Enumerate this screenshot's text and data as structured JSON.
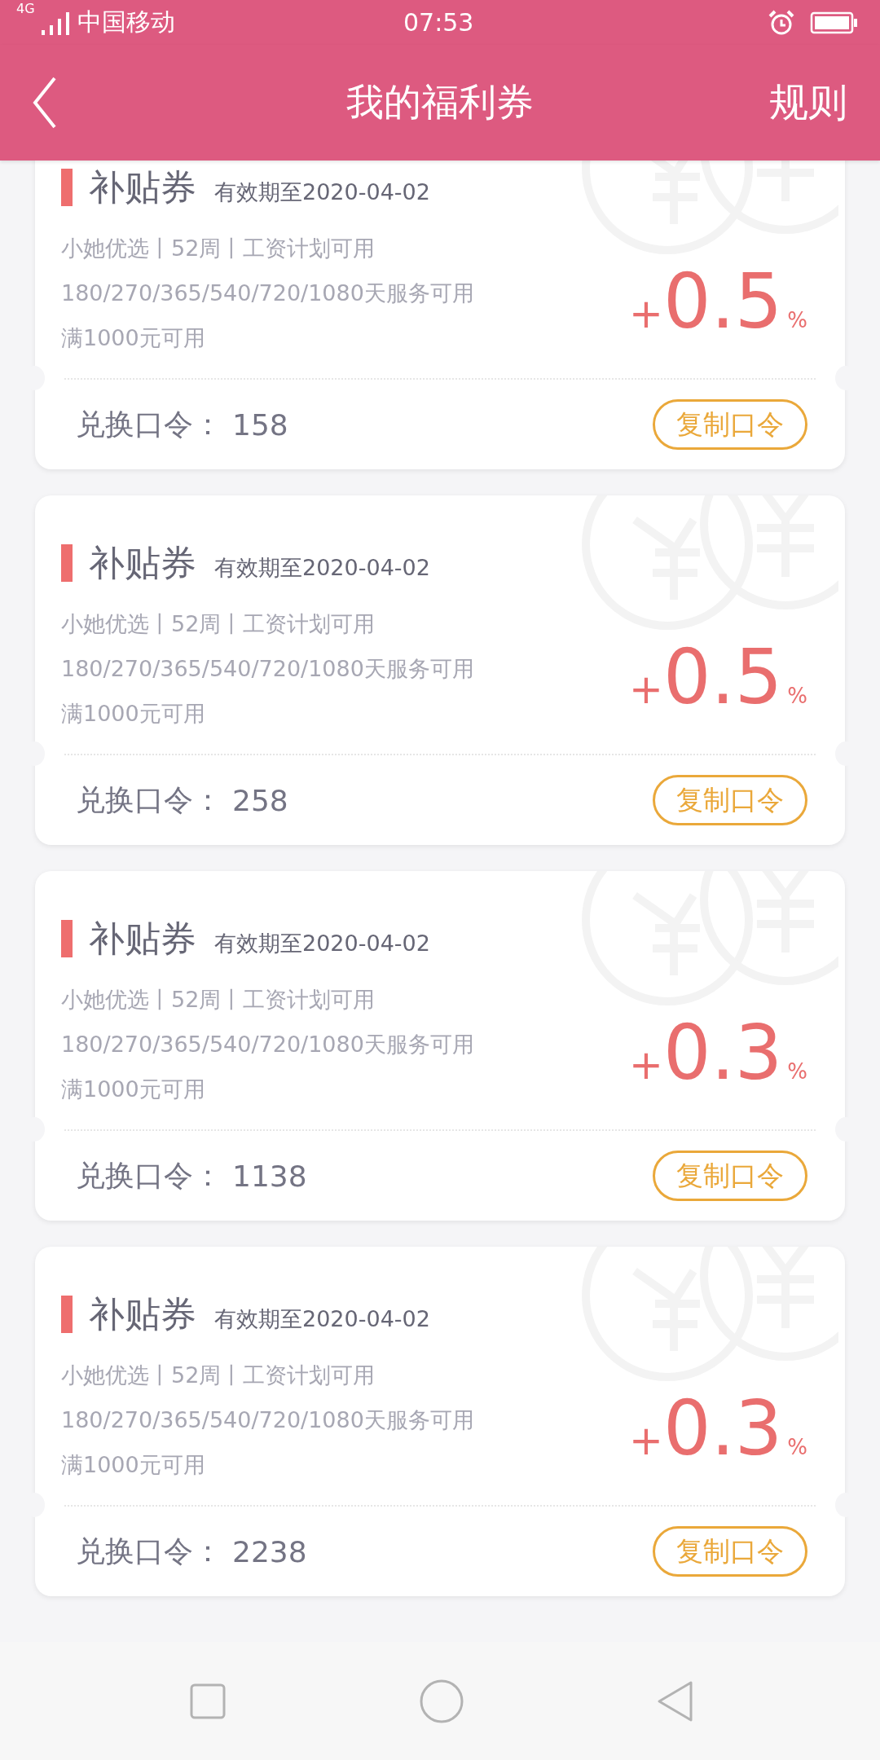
{
  "status_bar": {
    "network": "4G",
    "carrier": "中国移动",
    "time": "07:53"
  },
  "header": {
    "title": "我的福利券",
    "action": "规则"
  },
  "coupons": [
    {
      "title": "补贴券",
      "validity": "有效期至2020-04-02",
      "lines": [
        "小她优选丨52周丨工资计划可用",
        "180/270/365/540/720/1080天服务可用",
        "满1000元可用"
      ],
      "sign": "+",
      "value": "0.5",
      "unit": "%",
      "code_label": "兑换口令：",
      "code": "158",
      "button": "复制口令"
    },
    {
      "title": "补贴券",
      "validity": "有效期至2020-04-02",
      "lines": [
        "小她优选丨52周丨工资计划可用",
        "180/270/365/540/720/1080天服务可用",
        "满1000元可用"
      ],
      "sign": "+",
      "value": "0.5",
      "unit": "%",
      "code_label": "兑换口令：",
      "code": "258",
      "button": "复制口令"
    },
    {
      "title": "补贴券",
      "validity": "有效期至2020-04-02",
      "lines": [
        "小她优选丨52周丨工资计划可用",
        "180/270/365/540/720/1080天服务可用",
        "满1000元可用"
      ],
      "sign": "+",
      "value": "0.3",
      "unit": "%",
      "code_label": "兑换口令：",
      "code": "1138",
      "button": "复制口令"
    },
    {
      "title": "补贴券",
      "validity": "有效期至2020-04-02",
      "lines": [
        "小她优选丨52周丨工资计划可用",
        "180/270/365/540/720/1080天服务可用",
        "满1000元可用"
      ],
      "sign": "+",
      "value": "0.3",
      "unit": "%",
      "code_label": "兑换口令：",
      "code": "2238",
      "button": "复制口令"
    }
  ]
}
